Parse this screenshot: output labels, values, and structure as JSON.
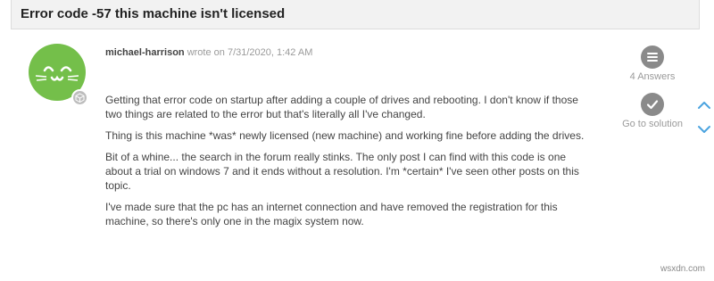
{
  "topic": {
    "title": "Error code -57 this machine isn't licensed"
  },
  "post": {
    "author": "michael-harrison",
    "wrote_on": "wrote on 7/31/2020, 1:42 AM",
    "paragraphs": [
      "Getting that error code on startup after adding a couple of drives and rebooting. I don't know if those two things are related to the error but that's literally all I've changed.",
      "Thing is this machine *was* newly licensed (new machine) and working fine before adding the drives.",
      "Bit of a whine... the search in the forum really stinks. The only post I can find with this code is one about a trial on windows 7 and it ends without a resolution. I'm *certain* I've seen other posts on this topic.",
      "I've made sure that the pc has an internet connection and have removed the registration for this machine, so there's only one in the magix system now."
    ]
  },
  "sidebar": {
    "answers_label": "4 Answers",
    "solution_label": "Go to solution"
  },
  "watermark": "wsxdn.com",
  "colors": {
    "avatar": "#74bf4a",
    "accent": "#4aa3df",
    "icon_grey": "#8a8a8a"
  },
  "icons": {
    "answers": "list-icon",
    "solution": "checkmark-icon",
    "nav_up": "chevron-up-icon",
    "nav_down": "chevron-down-icon"
  }
}
